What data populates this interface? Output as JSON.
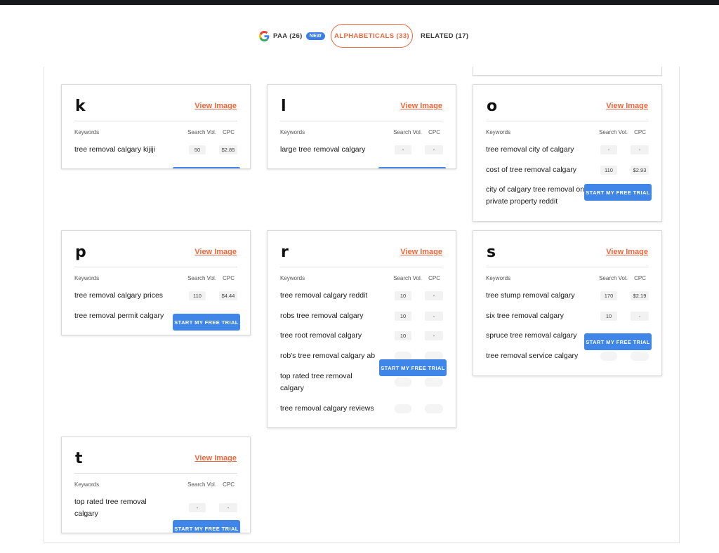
{
  "tabs": {
    "paa_label": "PAA (26)",
    "new_badge": "NEW",
    "alpha_label": "ALPHABETICALS (33)",
    "related_label": "RELATED (17)"
  },
  "common": {
    "view_image": "View Image",
    "col_keywords": "Keywords",
    "col_search_vol": "Search Vol.",
    "col_cpc": "CPC",
    "cta": "START MY FREE TRIAL"
  },
  "cards": {
    "k": {
      "letter": "k",
      "rows": [
        {
          "keyword": "tree removal calgary kijiji",
          "sv": "50",
          "cpc": "$2.85"
        }
      ]
    },
    "l": {
      "letter": "l",
      "rows": [
        {
          "keyword": "large tree removal calgary",
          "sv": "-",
          "cpc": "-"
        }
      ]
    },
    "o": {
      "letter": "o",
      "rows": [
        {
          "keyword": "tree removal city of calgary",
          "sv": "-",
          "cpc": "-"
        },
        {
          "keyword": "cost of tree removal calgary",
          "sv": "110",
          "cpc": "$2.93"
        },
        {
          "keyword": "city of calgary tree removal on private property reddit"
        }
      ]
    },
    "p": {
      "letter": "p",
      "rows": [
        {
          "keyword": "tree removal calgary prices",
          "sv": "110",
          "cpc": "$4.44"
        },
        {
          "keyword": "tree removal permit calgary"
        }
      ]
    },
    "r": {
      "letter": "r",
      "rows": [
        {
          "keyword": "tree removal calgary reddit",
          "sv": "10",
          "cpc": "-"
        },
        {
          "keyword": "robs tree removal calgary",
          "sv": "10",
          "cpc": "-"
        },
        {
          "keyword": "tree root removal calgary",
          "sv": "10",
          "cpc": "-"
        },
        {
          "keyword": "rob's tree removal calgary ab"
        },
        {
          "keyword": "top rated tree removal calgary"
        },
        {
          "keyword": "tree removal calgary reviews"
        }
      ]
    },
    "s": {
      "letter": "s",
      "rows": [
        {
          "keyword": "tree stump removal calgary",
          "sv": "170",
          "cpc": "$2.19"
        },
        {
          "keyword": "six tree removal calgary",
          "sv": "10",
          "cpc": "-"
        },
        {
          "keyword": "spruce tree removal calgary"
        },
        {
          "keyword": "tree removal service calgary"
        }
      ]
    },
    "t": {
      "letter": "t",
      "rows": [
        {
          "keyword": "top rated tree removal calgary",
          "sv": "-",
          "cpc": "-"
        }
      ]
    }
  }
}
